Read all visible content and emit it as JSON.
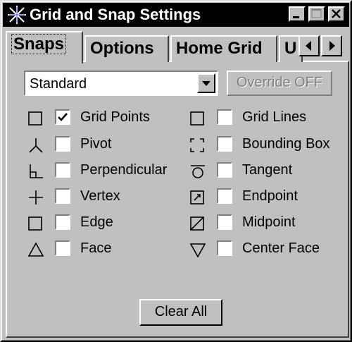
{
  "window": {
    "title": "Grid and Snap Settings"
  },
  "tabs": [
    {
      "label": "Snaps",
      "active": true
    },
    {
      "label": "Options",
      "active": false
    },
    {
      "label": "Home Grid",
      "active": false
    },
    {
      "label": "U",
      "active": false
    }
  ],
  "snap_set": {
    "selected": "Standard"
  },
  "override_button": "Override OFF",
  "left_column": [
    {
      "label": "Grid Points",
      "icon": "square-icon",
      "checked": true
    },
    {
      "label": "Pivot",
      "icon": "pivot-icon",
      "checked": false
    },
    {
      "label": "Perpendicular",
      "icon": "perpendicular-icon",
      "checked": false
    },
    {
      "label": "Vertex",
      "icon": "vertex-plus-icon",
      "checked": false
    },
    {
      "label": "Edge",
      "icon": "edge-square-icon",
      "checked": false
    },
    {
      "label": "Face",
      "icon": "face-triangle-icon",
      "checked": false
    }
  ],
  "right_column": [
    {
      "label": "Grid Lines",
      "icon": "square-icon",
      "checked": false
    },
    {
      "label": "Bounding Box",
      "icon": "bounding-box-icon",
      "checked": false
    },
    {
      "label": "Tangent",
      "icon": "tangent-icon",
      "checked": false
    },
    {
      "label": "Endpoint",
      "icon": "endpoint-icon",
      "checked": false
    },
    {
      "label": "Midpoint",
      "icon": "midpoint-icon",
      "checked": false
    },
    {
      "label": "Center Face",
      "icon": "center-face-triangle-icon",
      "checked": false
    }
  ],
  "clear_all_button": "Clear All"
}
